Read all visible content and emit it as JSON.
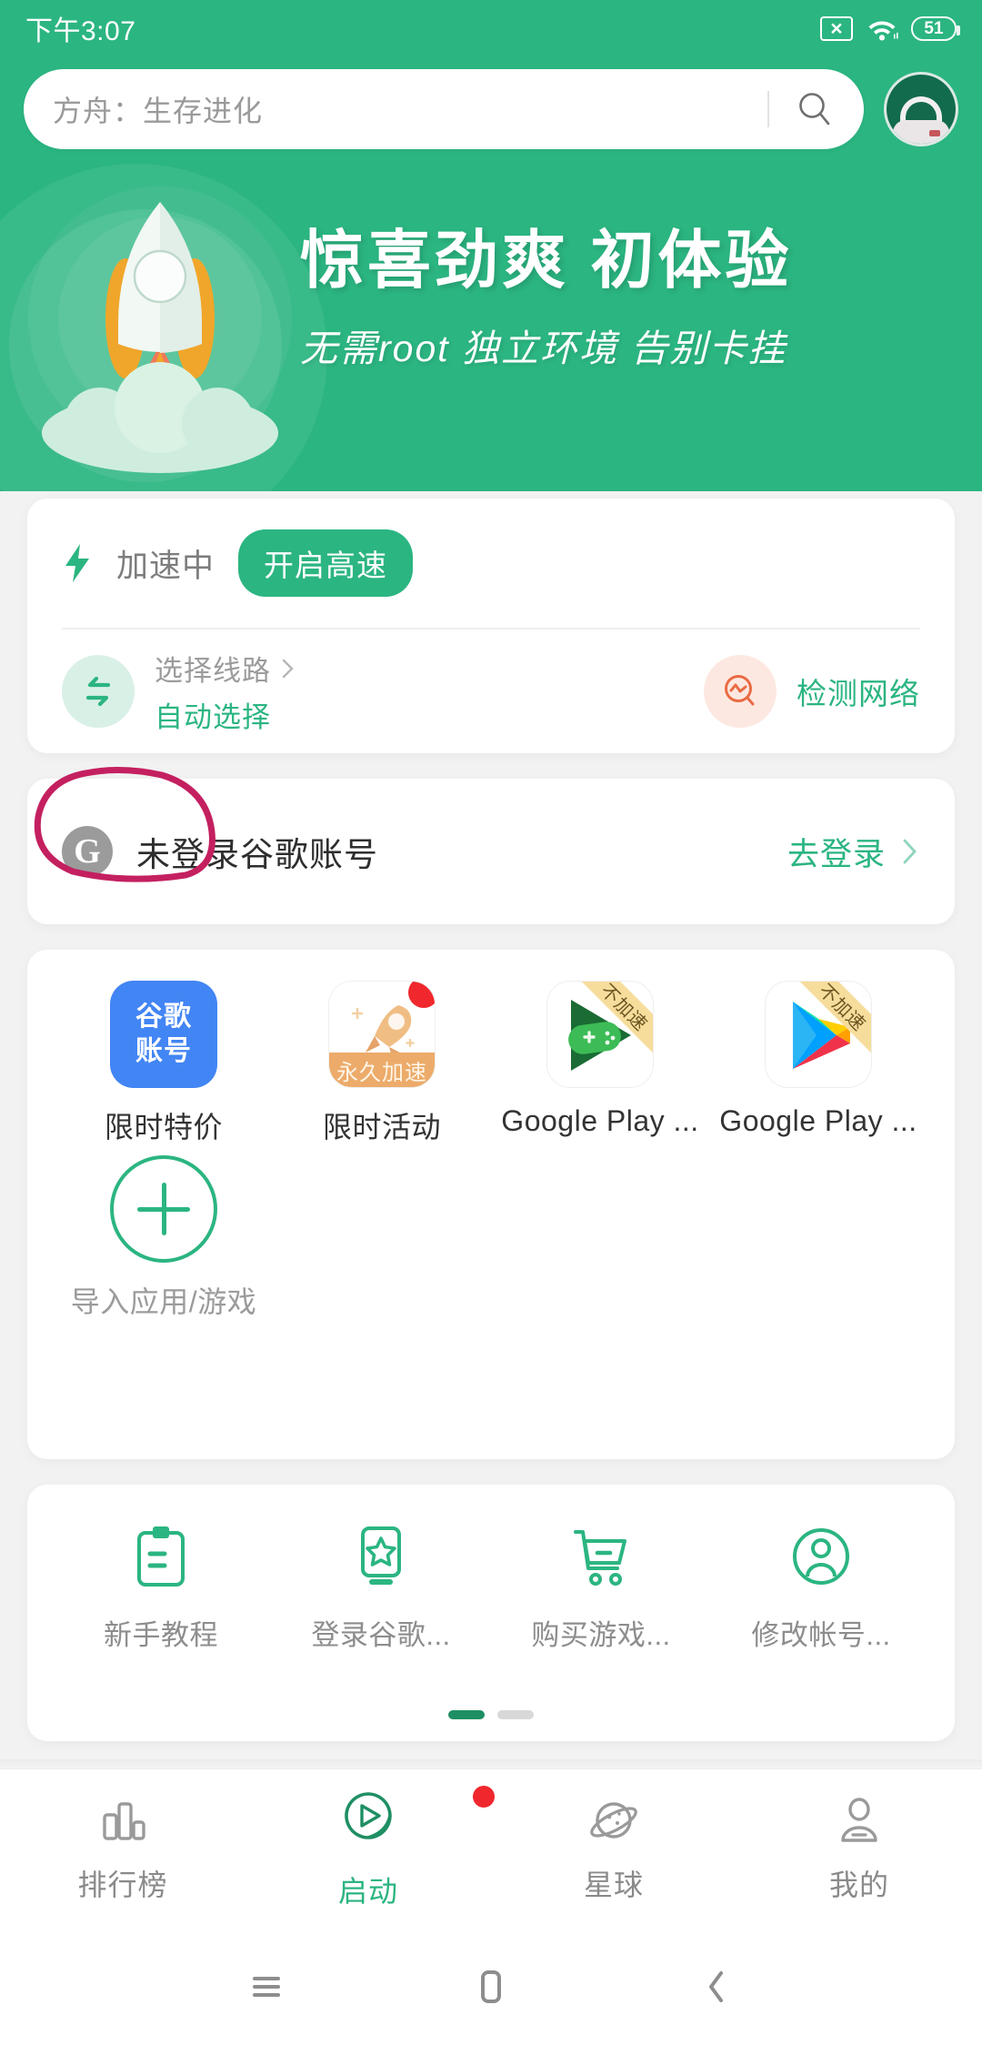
{
  "status_bar": {
    "time": "下午3:07",
    "battery_level": "51",
    "sim_icon": "sim-no-card-icon",
    "wifi_icon": "wifi-icon",
    "battery_icon": "battery-icon"
  },
  "search": {
    "value": "方舟：生存进化",
    "placeholder": "方舟：生存进化",
    "search_icon": "search-icon",
    "avatar_name": "astronaut-avatar"
  },
  "banner": {
    "title": "惊喜劲爽  初体验",
    "subtitle": "无需root  独立环境  告别卡挂",
    "illustration": "rocket-launch-illustration"
  },
  "accel_card": {
    "bolt_icon": "lightning-bolt-icon",
    "status_label": "加速中",
    "boost_button": "开启高速",
    "route_icon": "swap-arrows-icon",
    "route_title": "选择线路",
    "route_chevron": "chevron-right-icon",
    "route_value": "自动选择",
    "detect_icon": "network-pulse-search-icon",
    "detect_label": "检测网络"
  },
  "google_card": {
    "badge_letter": "G",
    "label": "未登录谷歌账号",
    "action": "去登录",
    "chevron": "chevron-right-icon",
    "annotation": "red-circle-highlight"
  },
  "apps": {
    "items": [
      {
        "icon_type": "google-account-tile",
        "icon_text": "谷歌\n账号",
        "icon_line1": "谷歌",
        "icon_line2": "账号",
        "label": "限时特价",
        "badge": "",
        "ribbon": ""
      },
      {
        "icon_type": "rocket-promo-tile",
        "icon_caption": "永久加速",
        "label": "限时活动",
        "badge": "red-dot-badge",
        "ribbon": ""
      },
      {
        "icon_type": "google-play-games-icon",
        "label": "Google Play ...",
        "badge": "",
        "ribbon": "不加速"
      },
      {
        "icon_type": "google-play-store-icon",
        "label": "Google Play ...",
        "badge": "",
        "ribbon": "不加速"
      }
    ],
    "import_label": "导入应用/游戏",
    "import_icon": "plus-circle-icon"
  },
  "shortcuts": {
    "items": [
      {
        "icon": "clipboard-icon",
        "label": "新手教程"
      },
      {
        "icon": "star-phone-icon",
        "label": "登录谷歌..."
      },
      {
        "icon": "shopping-cart-icon",
        "label": "购买游戏..."
      },
      {
        "icon": "user-circle-icon",
        "label": "修改帐号..."
      }
    ],
    "pager": {
      "total": 2,
      "active": 1
    }
  },
  "bottom_nav": {
    "items": [
      {
        "icon": "bar-chart-icon",
        "label": "排行榜",
        "active": false,
        "badge": ""
      },
      {
        "icon": "play-circle-icon",
        "label": "启动",
        "active": true,
        "badge": "red-dot-badge"
      },
      {
        "icon": "planet-icon",
        "label": "星球",
        "active": false,
        "badge": ""
      },
      {
        "icon": "person-icon",
        "label": "我的",
        "active": false,
        "badge": ""
      }
    ]
  },
  "system_nav": {
    "menu_icon": "menu-icon",
    "home_icon": "home-square-icon",
    "back_icon": "back-chevron-icon"
  },
  "colors": {
    "brand_green": "#2BB581",
    "accent_green": "#1F8F63",
    "badge_red": "#F0282D",
    "annotation_pink": "#C42060",
    "google_blue": "#4285F4",
    "ribbon_yellow": "#F6DD9C",
    "rocket_orange": "#ECAB6A"
  }
}
